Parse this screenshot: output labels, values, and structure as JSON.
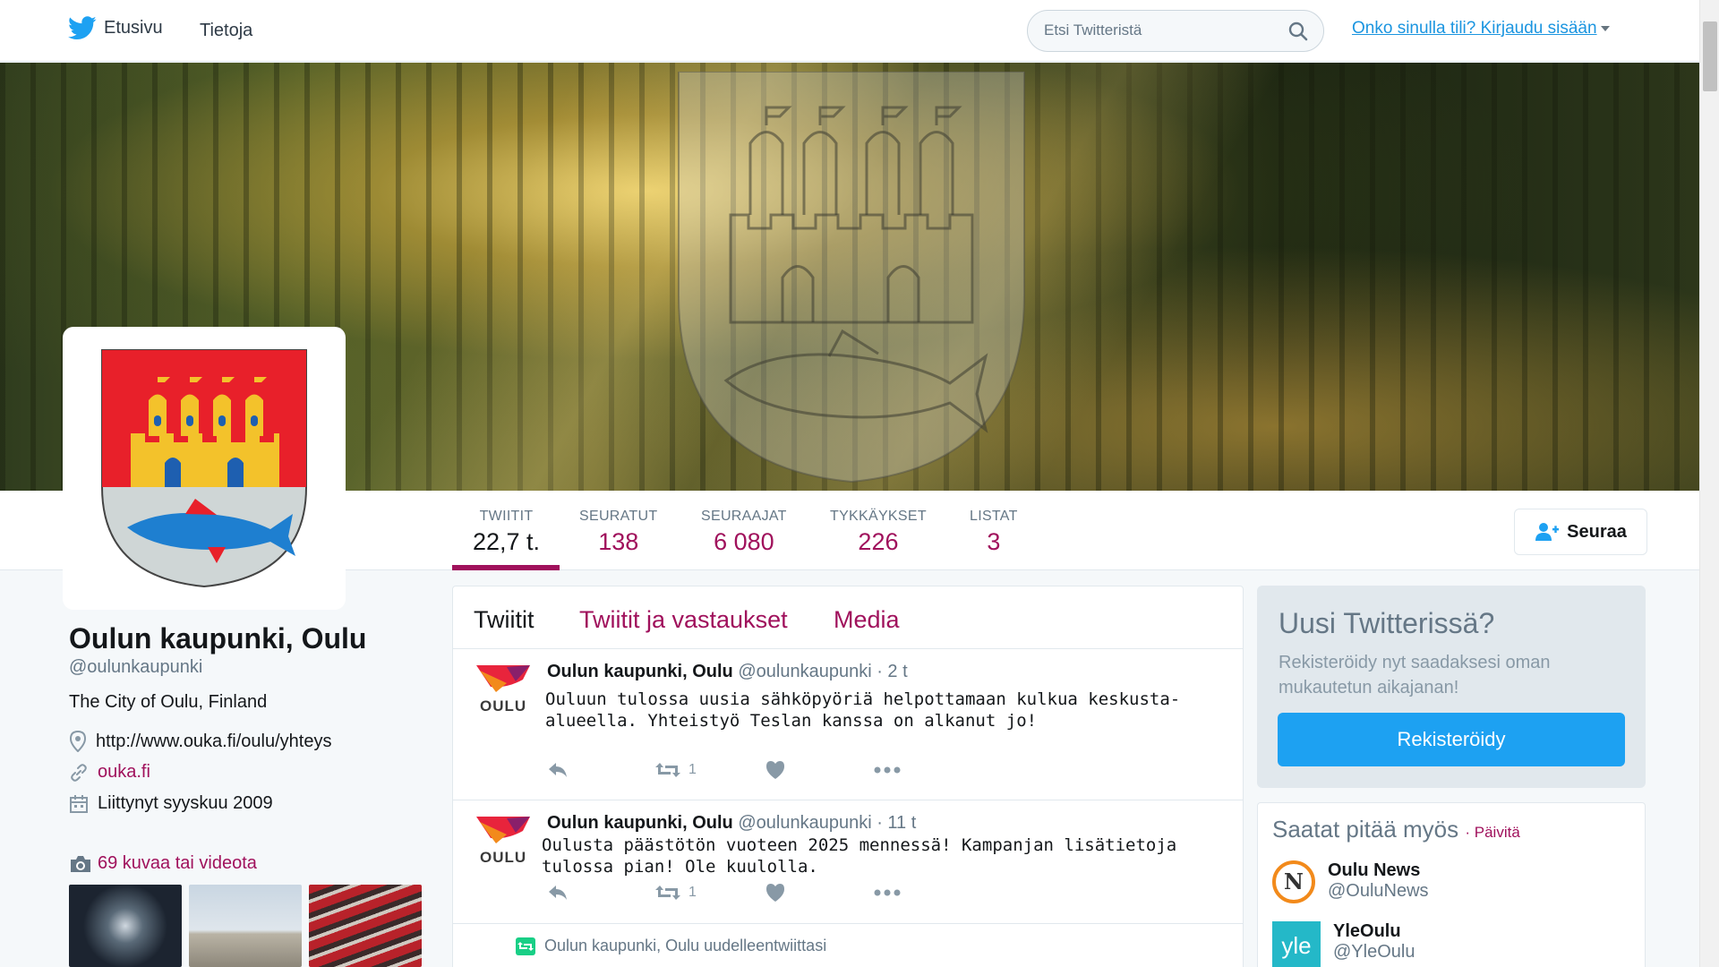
{
  "nav": {
    "home_label": "Etusivu",
    "about_label": "Tietoja",
    "search_placeholder": "Etsi Twitteristä",
    "login_label": "Onko sinulla tili? Kirjaudu sisään"
  },
  "stats": [
    {
      "label": "TWIITIT",
      "value": "22,7 t."
    },
    {
      "label": "SEURATUT",
      "value": "138"
    },
    {
      "label": "SEURAAJAT",
      "value": "6 080"
    },
    {
      "label": "TYKKÄYKSET",
      "value": "226"
    },
    {
      "label": "LISTAT",
      "value": "3"
    }
  ],
  "follow_label": "Seuraa",
  "profile": {
    "name": "Oulun kaupunki, Oulu",
    "handle": "@oulunkaupunki",
    "bio": "The City of Oulu, Finland",
    "location": "http://www.ouka.fi/oulu/yhteys",
    "website": "ouka.fi",
    "joined": "Liittynyt syyskuu 2009",
    "media_count": "69 kuvaa tai videota"
  },
  "tabs": [
    "Twiitit",
    "Twiitit ja vastaukset",
    "Media"
  ],
  "tweets": [
    {
      "name": "Oulun kaupunki, Oulu",
      "handle": "@oulunkaupunki",
      "time": "· 2 t",
      "avatar_label": "OULU",
      "text": "Ouluun tulossa uusia sähköpyöriä helpottamaan kulkua keskusta-alueella. Yhteistyö Teslan kanssa on alkanut jo!",
      "retweets": "1"
    },
    {
      "name": "Oulun kaupunki, Oulu",
      "handle": "@oulunkaupunki",
      "time": "· 11 t",
      "avatar_label": "OULU",
      "text": "Oulusta päästötön vuoteen 2025 mennessä! Kampanjan lisätietoja tulossa pian! Ole kuulolla.",
      "retweets": "1"
    }
  ],
  "retweet_note": "Oulun kaupunki, Oulu uudelleentwiittasi",
  "signup": {
    "title": "Uusi Twitterissä?",
    "desc": "Rekisteröidy nyt saadaksesi oman mukautetun aikajanan!",
    "button": "Rekisteröidy"
  },
  "suggestions": {
    "title": "Saatat pitää myös",
    "refresh": "· Päivitä",
    "users": [
      {
        "name": "Oulu News",
        "handle": "@OuluNews",
        "avatar_text": "N"
      },
      {
        "name": "YleOulu",
        "handle": "@YleOulu",
        "avatar_text": "yle"
      }
    ]
  },
  "colors": {
    "accent": "#a0115c",
    "twitter_blue": "#1da1f2",
    "link_blue": "#1b95e0"
  }
}
